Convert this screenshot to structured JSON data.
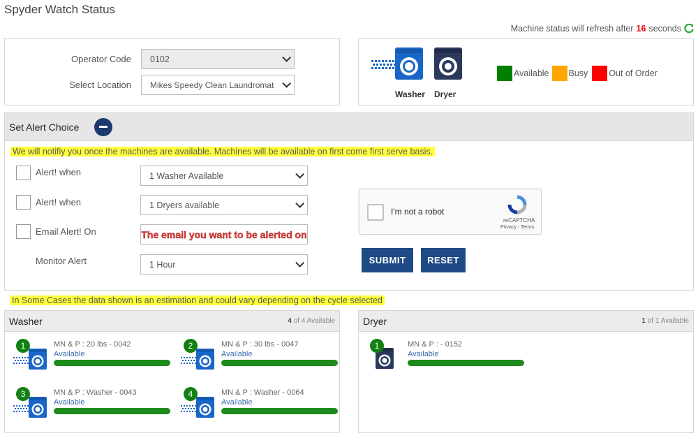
{
  "page": {
    "title": "Spyder Watch Status",
    "refresh_prefix": "Machine status will refresh after",
    "refresh_seconds": "16",
    "refresh_suffix": "seconds"
  },
  "filters": {
    "operator_label": "Operator Code",
    "operator_value": "0102",
    "location_label": "Select Location",
    "location_value": "Mikes Speedy Clean Laundromat"
  },
  "legend": {
    "washer_label": "Washer",
    "dryer_label": "Dryer",
    "items": [
      {
        "label": "Available",
        "color": "#008000"
      },
      {
        "label": "Busy",
        "color": "#FFA500"
      },
      {
        "label": "Out of Order",
        "color": "#FF0000"
      }
    ]
  },
  "alerts": {
    "header": "Set Alert Choice",
    "notice": "We will notifiy you once the machines are available. Machines will be available on first come first serve basis.",
    "washer_alert_label": "Alert! when",
    "washer_alert_value": "1 Washer Available",
    "dryer_alert_label": "Alert! when",
    "dryer_alert_value": "1 Dryers available",
    "email_label": "Email Alert! On",
    "email_placeholder": "The email you want to be alerted on",
    "monitor_label": "Monitor Alert",
    "monitor_value": "1 Hour",
    "captcha_text": "I'm not a robot",
    "captcha_brand": "reCAPTCHA",
    "captcha_links": "Privacy - Terms",
    "submit_label": "SUBMIT",
    "reset_label": "RESET"
  },
  "estimate_notice": "In Some Cases the data shown is an estimation and could vary depending on the cycle selected",
  "washers": {
    "title": "Washer",
    "available_count": "4",
    "total_text": "of 4 Available",
    "machines": [
      {
        "num": "1",
        "name": "MN & P : 20 lbs - 0042",
        "status": "Available"
      },
      {
        "num": "2",
        "name": "MN & P : 30 lbs - 0047",
        "status": "Available"
      },
      {
        "num": "3",
        "name": "MN & P : Washer - 0043",
        "status": "Available"
      },
      {
        "num": "4",
        "name": "MN & P : Washer - 0064",
        "status": "Available"
      }
    ]
  },
  "dryers": {
    "title": "Dryer",
    "available_count": "1",
    "total_text": "of 1 Available",
    "machines": [
      {
        "num": "1",
        "name": "MN & P : - 0152",
        "status": "Available"
      }
    ]
  }
}
